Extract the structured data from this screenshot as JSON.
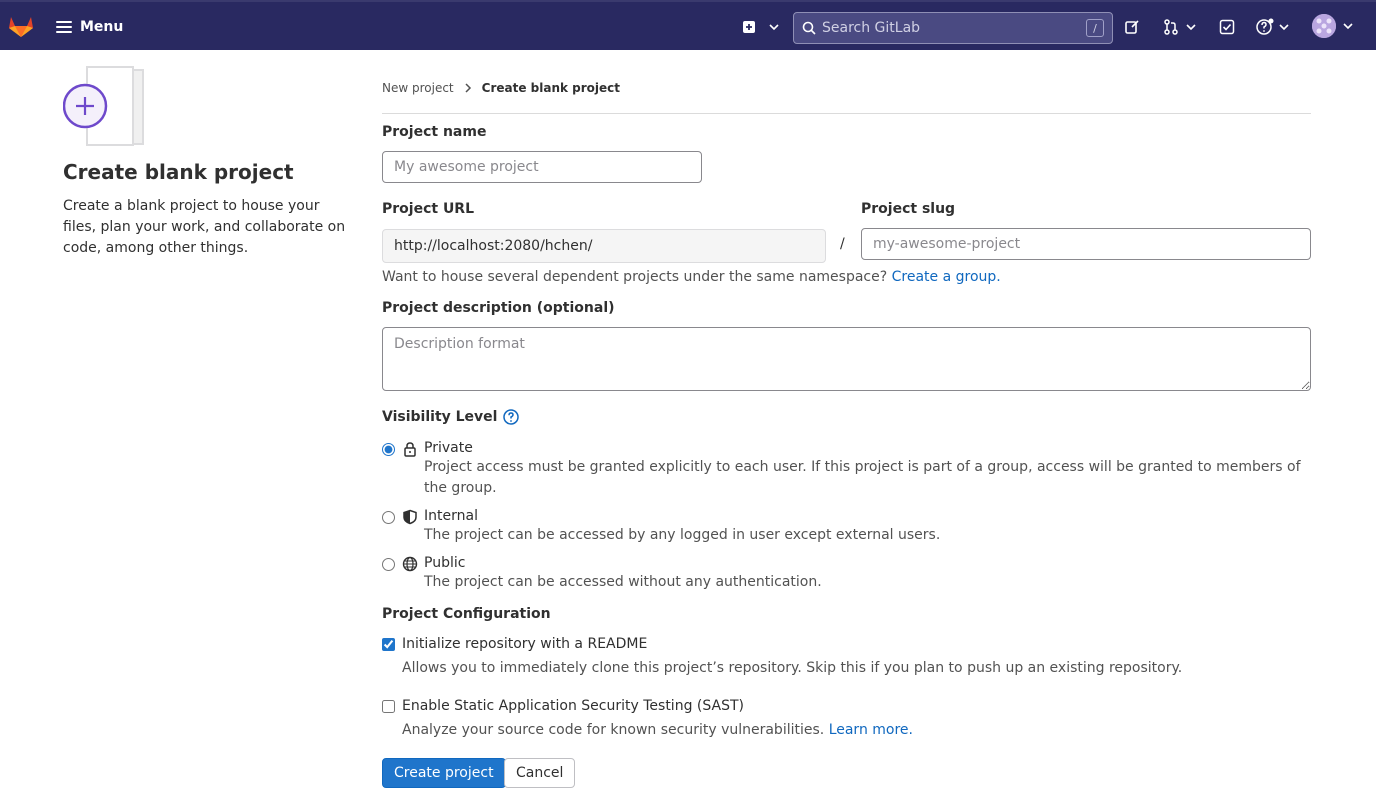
{
  "nav": {
    "menu_label": "Menu",
    "search_placeholder": "Search GitLab",
    "search_shortcut": "/"
  },
  "left": {
    "title": "Create blank project",
    "description": "Create a blank project to house your files, plan your work, and collaborate on code, among other things."
  },
  "breadcrumb": {
    "parent": "New project",
    "current": "Create blank project"
  },
  "form": {
    "project_name_label": "Project name",
    "project_name_placeholder": "My awesome project",
    "project_url_label": "Project URL",
    "project_url_value": "http://localhost:2080/hchen/",
    "slash": "/",
    "project_slug_label": "Project slug",
    "project_slug_placeholder": "my-awesome-project",
    "namespace_help": "Want to house several dependent projects under the same namespace?",
    "namespace_link": "Create a group.",
    "description_label": "Project description (optional)",
    "description_placeholder": "Description format",
    "visibility_label": "Visibility Level",
    "visibility": [
      {
        "title": "Private",
        "desc": "Project access must be granted explicitly to each user. If this project is part of a group, access will be granted to members of the group.",
        "checked": true
      },
      {
        "title": "Internal",
        "desc": "The project can be accessed by any logged in user except external users.",
        "checked": false
      },
      {
        "title": "Public",
        "desc": "The project can be accessed without any authentication.",
        "checked": false
      }
    ],
    "config_label": "Project Configuration",
    "readme_label": "Initialize repository with a README",
    "readme_desc": "Allows you to immediately clone this project’s repository. Skip this if you plan to push up an existing repository.",
    "readme_checked": true,
    "sast_label": "Enable Static Application Security Testing (SAST)",
    "sast_desc": "Analyze your source code for known security vulnerabilities.",
    "sast_link": "Learn more.",
    "sast_checked": false,
    "create_button": "Create project",
    "cancel_button": "Cancel"
  },
  "colors": {
    "navbar": "#292961",
    "primary": "#1f75cb",
    "link": "#1068bf"
  }
}
